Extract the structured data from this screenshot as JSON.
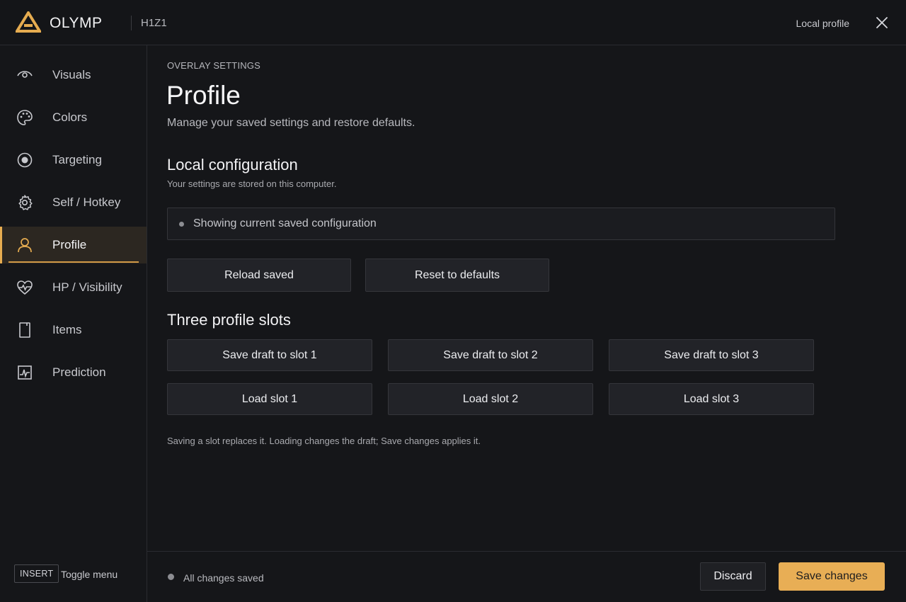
{
  "header": {
    "brand": "OLYMP",
    "game": "H1Z1",
    "profile_label": "Local profile",
    "accent_color": "#e6ac50"
  },
  "sidebar": {
    "items": [
      {
        "label": "Visuals",
        "icon": "eye-icon",
        "active": false
      },
      {
        "label": "Colors",
        "icon": "palette-icon",
        "active": false
      },
      {
        "label": "Targeting",
        "icon": "target-icon",
        "active": false
      },
      {
        "label": "Self / Hotkey",
        "icon": "gear-icon",
        "active": false
      },
      {
        "label": "Profile",
        "icon": "user-icon",
        "active": true
      },
      {
        "label": "HP / Visibility",
        "icon": "heart-pulse-icon",
        "active": false
      },
      {
        "label": "Items",
        "icon": "phone-icon",
        "active": false
      },
      {
        "label": "Prediction",
        "icon": "chart-pulse-icon",
        "active": false
      }
    ],
    "toggle_key": "INSERT",
    "toggle_label": "Toggle menu"
  },
  "main": {
    "eyebrow": "OVERLAY SETTINGS",
    "title": "Profile",
    "subtitle": "Manage your saved settings and restore defaults.",
    "local_section": {
      "title": "Local configuration",
      "description": "Your settings are stored on this computer.",
      "status": "Showing current saved configuration",
      "reload_label": "Reload saved",
      "reset_label": "Reset to defaults"
    },
    "slots_section": {
      "title": "Three profile slots",
      "save_labels": [
        "Save draft to slot 1",
        "Save draft to slot 2",
        "Save draft to slot 3"
      ],
      "load_labels": [
        "Load slot 1",
        "Load slot 2",
        "Load slot 3"
      ],
      "note": "Saving a slot replaces it. Loading changes the draft; Save changes applies it."
    }
  },
  "footer": {
    "status": "All changes saved",
    "discard_label": "Discard",
    "save_label": "Save changes"
  }
}
